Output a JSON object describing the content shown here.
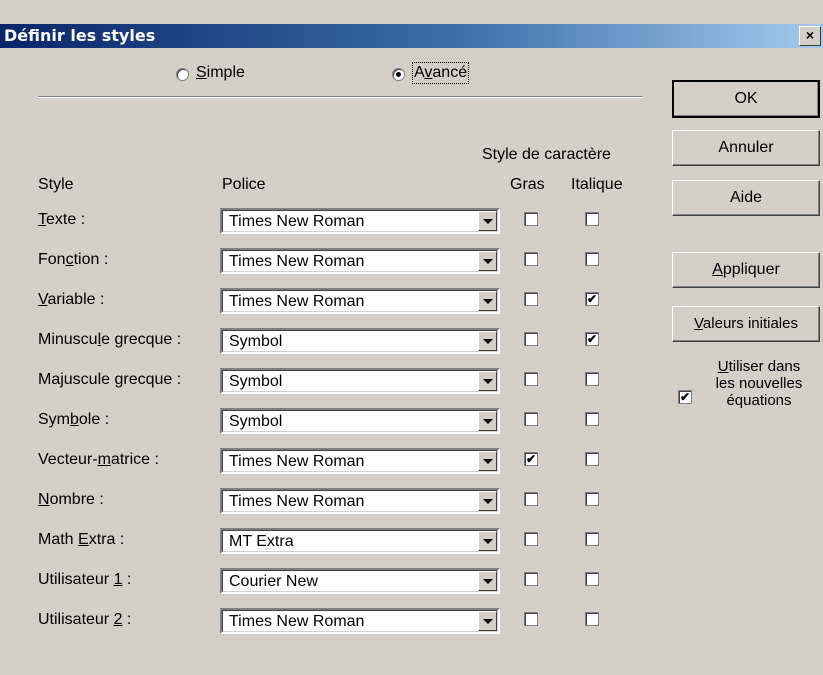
{
  "dialog": {
    "title": "Définir les styles",
    "close_label": "×"
  },
  "mode": {
    "simple": {
      "label_pre": "",
      "label_u": "S",
      "label_post": "imple",
      "selected": false
    },
    "advanced": {
      "label_pre": "A",
      "label_u": "v",
      "label_post": "ancé",
      "selected": true
    }
  },
  "headers": {
    "group": "Style de caractère",
    "style": "Style",
    "font": "Police",
    "bold": "Gras",
    "italic": "Italique"
  },
  "rows": [
    {
      "pre": "",
      "u": "T",
      "post": "exte :",
      "font": "Times New Roman",
      "bold": false,
      "italic": false
    },
    {
      "pre": "Fon",
      "u": "c",
      "post": "tion :",
      "font": "Times New Roman",
      "bold": false,
      "italic": false
    },
    {
      "pre": "",
      "u": "V",
      "post": "ariable :",
      "font": "Times New Roman",
      "bold": false,
      "italic": true
    },
    {
      "pre": "Minuscu",
      "u": "l",
      "post": "e grecque :",
      "font": "Symbol",
      "bold": false,
      "italic": true
    },
    {
      "pre": "Majuscule ",
      "u": "g",
      "post": "recque :",
      "font": "Symbol",
      "bold": false,
      "italic": false
    },
    {
      "pre": "Sym",
      "u": "b",
      "post": "ole :",
      "font": "Symbol",
      "bold": false,
      "italic": false
    },
    {
      "pre": "Vecteur-",
      "u": "m",
      "post": "atrice :",
      "font": "Times New Roman",
      "bold": true,
      "italic": false
    },
    {
      "pre": "",
      "u": "N",
      "post": "ombre :",
      "font": "Times New Roman",
      "bold": false,
      "italic": false
    },
    {
      "pre": "Math ",
      "u": "E",
      "post": "xtra :",
      "font": "MT Extra",
      "bold": false,
      "italic": false
    },
    {
      "pre": "Utilisateur ",
      "u": "1",
      "post": " :",
      "font": "Courier New",
      "bold": false,
      "italic": false
    },
    {
      "pre": "Utilisateur ",
      "u": "2",
      "post": " :",
      "font": "Times New Roman",
      "bold": false,
      "italic": false
    }
  ],
  "buttons": {
    "ok": "OK",
    "cancel": "Annuler",
    "help": "Aide",
    "apply_u": "A",
    "apply_post": "ppliquer",
    "reset_u": "V",
    "reset_post": "aleurs initiales"
  },
  "use_new": {
    "checked": true,
    "line1_u": "U",
    "line1_post": "tiliser dans",
    "line2": "les nouvelles",
    "line3": "équations"
  },
  "check_mark": "✔"
}
